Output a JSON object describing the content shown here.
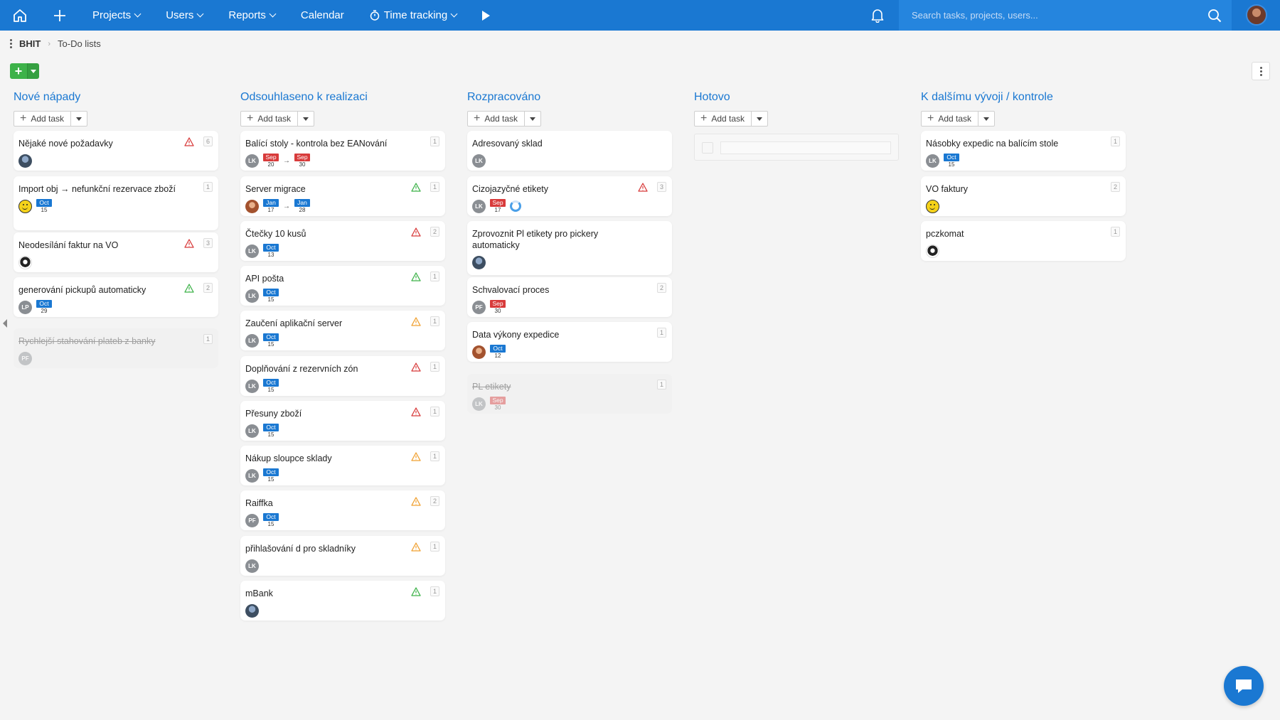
{
  "nav": {
    "projects": "Projects",
    "users": "Users",
    "reports": "Reports",
    "calendar": "Calendar",
    "time_tracking": "Time tracking",
    "search_placeholder": "Search tasks, projects, users..."
  },
  "breadcrumb": {
    "project": "BHIT",
    "page": "To-Do lists"
  },
  "add_task_label": "Add task",
  "columns": [
    {
      "title": "Nové nápady",
      "cards": [
        {
          "title": "Nějaké nové požadavky",
          "count": "6",
          "warn": "red",
          "avatar": "photo1",
          "dates": []
        },
        {
          "title": "Import obj → nefunkční rezervace zboží",
          "count": "1",
          "avatar": "smile",
          "dates": [
            {
              "month": "Oct",
              "day": "15",
              "color": "blue"
            }
          ]
        },
        {
          "title": "Neodesílání faktur na VO",
          "count": "3",
          "warn": "red",
          "avatar": "bw",
          "dates": []
        },
        {
          "title": "generování pickupů automaticky",
          "count": "2",
          "warn": "green",
          "avatar": "LP",
          "dates": [
            {
              "month": "Oct",
              "day": "29",
              "color": "blue"
            }
          ]
        },
        {
          "title": "Rychlejší stahování plateb z banky",
          "count": "1",
          "avatar": "PF",
          "done": true,
          "dates": []
        }
      ]
    },
    {
      "title": "Odsouhlaseno k realizaci",
      "cards": [
        {
          "title": "Balící stoly - kontrola bez EANování",
          "count": "1",
          "avatar": "LK",
          "dates": [
            {
              "month": "Sep",
              "day": "20",
              "color": "red"
            },
            {
              "month": "Sep",
              "day": "30",
              "color": "red"
            }
          ]
        },
        {
          "title": "Server migrace",
          "count": "1",
          "warn": "green",
          "avatar": "photo2",
          "dates": [
            {
              "month": "Jan",
              "day": "17",
              "color": "blue"
            },
            {
              "month": "Jan",
              "day": "28",
              "color": "blue"
            }
          ]
        },
        {
          "title": "Čtečky 10 kusů",
          "count": "2",
          "warn": "red",
          "avatar": "LK",
          "dates": [
            {
              "month": "Oct",
              "day": "13",
              "color": "blue"
            }
          ]
        },
        {
          "title": "API pošta",
          "count": "1",
          "warn": "green",
          "avatar": "LK",
          "dates": [
            {
              "month": "Oct",
              "day": "15",
              "color": "blue"
            }
          ]
        },
        {
          "title": "Zaučení aplikační server",
          "count": "1",
          "warn": "orange",
          "avatar": "LK",
          "dates": [
            {
              "month": "Oct",
              "day": "15",
              "color": "blue"
            }
          ]
        },
        {
          "title": "Doplňování z rezervních zón",
          "count": "1",
          "warn": "red",
          "avatar": "LK",
          "dates": [
            {
              "month": "Oct",
              "day": "15",
              "color": "blue"
            }
          ]
        },
        {
          "title": "Přesuny zboží",
          "count": "1",
          "warn": "red",
          "avatar": "LK",
          "dates": [
            {
              "month": "Oct",
              "day": "15",
              "color": "blue"
            }
          ]
        },
        {
          "title": "Nákup sloupce sklady",
          "count": "1",
          "warn": "orange",
          "avatar": "LK",
          "dates": [
            {
              "month": "Oct",
              "day": "15",
              "color": "blue"
            }
          ]
        },
        {
          "title": "Raiffka",
          "count": "2",
          "warn": "orange",
          "avatar": "PF",
          "dates": [
            {
              "month": "Oct",
              "day": "15",
              "color": "blue"
            }
          ]
        },
        {
          "title": "přihlašování d pro skladníky",
          "count": "1",
          "warn": "orange",
          "avatar": "LK",
          "dates": []
        },
        {
          "title": "mBank",
          "count": "1",
          "warn": "green",
          "avatar": "photo1",
          "dates": []
        }
      ]
    },
    {
      "title": "Rozpracováno",
      "cards": [
        {
          "title": "Adresovaný sklad",
          "avatar": "LK",
          "dates": []
        },
        {
          "title": "Cizojazyčné etikety",
          "count": "3",
          "warn": "red",
          "avatar": "LK",
          "dates": [
            {
              "month": "Sep",
              "day": "17",
              "color": "red"
            }
          ],
          "ring": true
        },
        {
          "title": "Zprovoznit Pl etikety pro pickery automaticky",
          "avatar": "photo1",
          "dates": []
        },
        {
          "title": "Schvalovací proces",
          "count": "2",
          "avatar": "PF",
          "dates": [
            {
              "month": "Sep",
              "day": "30",
              "color": "red"
            }
          ]
        },
        {
          "title": "Data výkony expedice",
          "count": "1",
          "avatar": "photo2",
          "dates": [
            {
              "month": "Oct",
              "day": "12",
              "color": "blue"
            }
          ]
        },
        {
          "title": "PL etikety",
          "count": "1",
          "avatar": "LK",
          "done": true,
          "dates": [
            {
              "month": "Sep",
              "day": "30",
              "color": "red"
            }
          ]
        }
      ]
    },
    {
      "title": "Hotovo",
      "cards": []
    },
    {
      "title": "K dalšímu vývoji / kontrole",
      "cards": [
        {
          "title": "Násobky expedic na balícím stole",
          "count": "1",
          "avatar": "LK",
          "dates": [
            {
              "month": "Oct",
              "day": "15",
              "color": "blue"
            }
          ]
        },
        {
          "title": "VO faktury",
          "count": "2",
          "avatar": "smile",
          "dates": []
        },
        {
          "title": "pczkomat",
          "count": "1",
          "avatar": "bw",
          "dates": []
        }
      ]
    }
  ],
  "colors": {
    "topbar": "#1a78d2",
    "accent": "#1a78d2",
    "add_green": "#3db249",
    "date_red": "#d83b3b",
    "warn_red": "#d83b3b",
    "warn_green": "#3db249",
    "warn_orange": "#f0a030"
  }
}
